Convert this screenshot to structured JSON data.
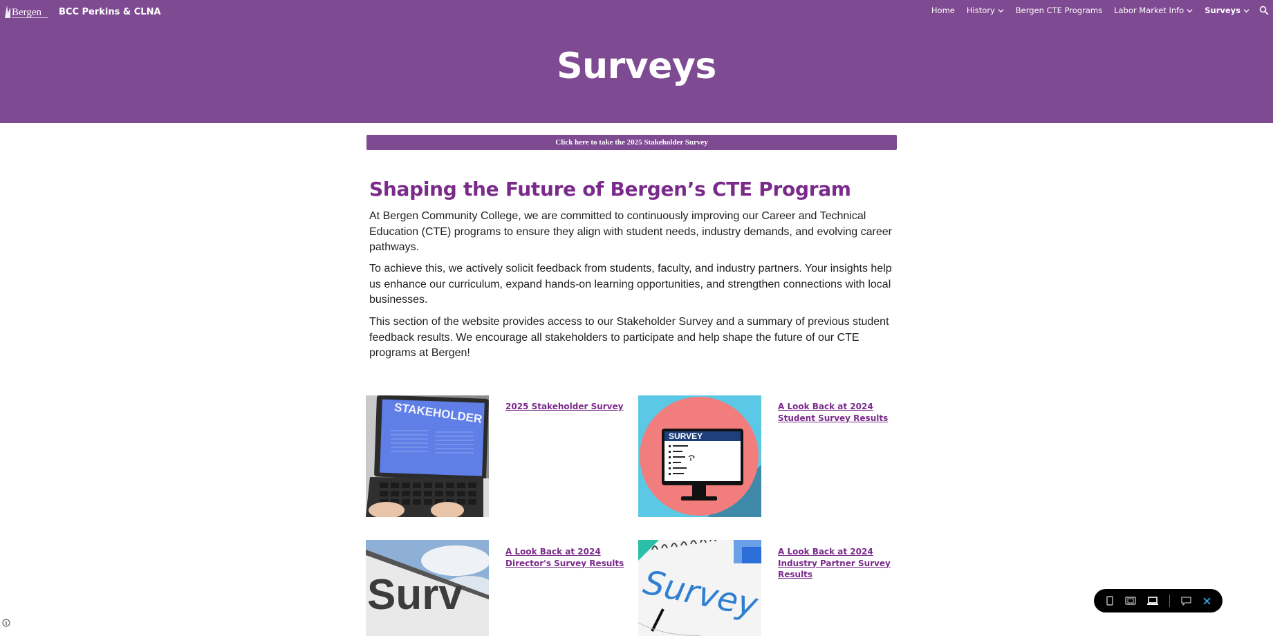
{
  "header": {
    "site_title": "BCC Perkins & CLNA",
    "logo_text": "Bergen",
    "nav": [
      {
        "label": "Home",
        "dropdown": false
      },
      {
        "label": "History",
        "dropdown": true
      },
      {
        "label": "Bergen CTE Programs",
        "dropdown": false
      },
      {
        "label": "Labor Market Info",
        "dropdown": true
      },
      {
        "label": "Surveys",
        "dropdown": true,
        "active": true
      }
    ],
    "page_title": "Surveys",
    "colors": {
      "band": "#7e4a91",
      "heading": "#7a2a8a"
    }
  },
  "cta": {
    "label": "Click here to take the 2025 Stakeholder Survey"
  },
  "article": {
    "heading": "Shaping the Future of Bergen’s CTE Program",
    "paragraphs": [
      "At Bergen Community College, we are committed to continuously improving our Career and Technical Education (CTE) programs to ensure they align with student needs, industry demands, and evolving career pathways.",
      "To achieve this, we actively solicit feedback from students, faculty, and industry partners. Your insights help us enhance our curriculum, expand hands-on learning opportunities, and strengthen connections with local businesses.",
      "This section of the website provides access to our Stakeholder Survey and a summary of previous student feedback results. We encourage all stakeholders to participate and help shape the future of our CTE programs at Bergen!"
    ]
  },
  "cards": [
    {
      "link": "2025 Stakeholder Survey",
      "image": "stakeholder-laptop",
      "image_text": "STAKEHOLDER"
    },
    {
      "link": "A Look Back at 2024 Student Survey Results",
      "image": "survey-monitor",
      "image_text": "SURVEY"
    },
    {
      "link": "A Look Back at 2024 Director's Survey Results",
      "image": "survey-sign",
      "image_text": "Surv"
    },
    {
      "link": "A Look Back at 2024 Industry Partner Survey Results",
      "image": "survey-notebook",
      "image_text": "Survey"
    }
  ],
  "toolbar": {
    "icons": [
      "mobile-view-icon",
      "tablet-view-icon",
      "desktop-view-icon",
      "feedback-icon",
      "close-icon"
    ]
  }
}
